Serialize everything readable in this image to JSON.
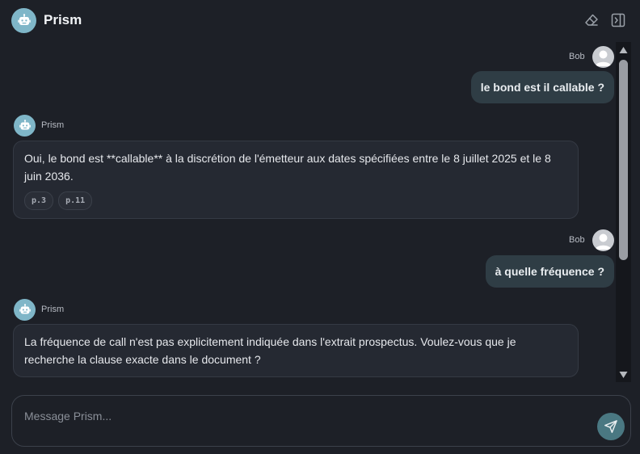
{
  "header": {
    "title": "Prism",
    "avatar_icon": "robot-icon",
    "actions": [
      {
        "icon": "eraser-icon"
      },
      {
        "icon": "sidebar-panel-icon"
      }
    ]
  },
  "messages": [
    {
      "role": "user",
      "author": "Bob",
      "text": "le bond est il callable ?"
    },
    {
      "role": "assistant",
      "author": "Prism",
      "text": "Oui, le bond est **callable** à la discrétion de l'émetteur aux dates spécifiées entre le 8 juillet 2025 et le 8 juin 2036.",
      "citations": [
        "p.3",
        "p.11"
      ]
    },
    {
      "role": "user",
      "author": "Bob",
      "text": "à quelle fréquence ?"
    },
    {
      "role": "assistant",
      "author": "Prism",
      "text": "La fréquence de call n'est pas explicitement indiquée dans l'extrait prospectus. Voulez-vous que je recherche la clause exacte dans le document ?"
    }
  ],
  "composer": {
    "placeholder": "Message Prism...",
    "value": ""
  },
  "colors": {
    "background": "#1d2027",
    "user_bubble": "#2f3d45",
    "assistant_bubble": "#252932",
    "accent": "#7fb6c8",
    "send_button": "#4a7882"
  }
}
